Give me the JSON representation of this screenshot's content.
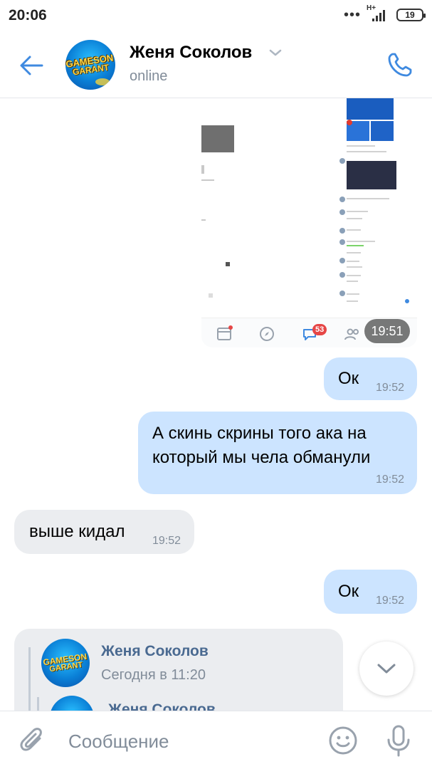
{
  "status_bar": {
    "time": "20:06",
    "network": "H+",
    "battery": "19"
  },
  "header": {
    "contact_name": "Женя Соколов",
    "contact_status": "online",
    "avatar_text_line1": "GAMESON",
    "avatar_text_line2": "GARANT"
  },
  "messages": [
    {
      "type": "image",
      "direction": "out",
      "time": "19:51",
      "nav_badge": "53"
    },
    {
      "type": "text",
      "direction": "out",
      "text": "Ок",
      "time": "19:52"
    },
    {
      "type": "text",
      "direction": "out",
      "text": "А скинь скрины того ака на который мы чела обманули",
      "time": "19:52"
    },
    {
      "type": "text",
      "direction": "in",
      "text": "выше кидал",
      "time": "19:52"
    },
    {
      "type": "text",
      "direction": "out",
      "text": "Ок",
      "time": "19:52"
    },
    {
      "type": "forwarded",
      "direction": "in",
      "author": "Женя Соколов",
      "date": "Сегодня в 11:20",
      "nested_author": "Женя Соколов"
    }
  ],
  "composer": {
    "placeholder": "Сообщение"
  },
  "icons": {
    "back": "arrow-left-icon",
    "call": "phone-icon",
    "attach": "paperclip-icon",
    "emoji": "smile-icon",
    "mic": "microphone-icon",
    "scroll_down": "chevron-down-icon"
  },
  "colors": {
    "accent": "#3f8ae0",
    "outgoing_bubble": "#cce4ff",
    "incoming_bubble": "#ebedf0",
    "secondary_text": "#818c99",
    "link_name": "#4a6a91"
  }
}
